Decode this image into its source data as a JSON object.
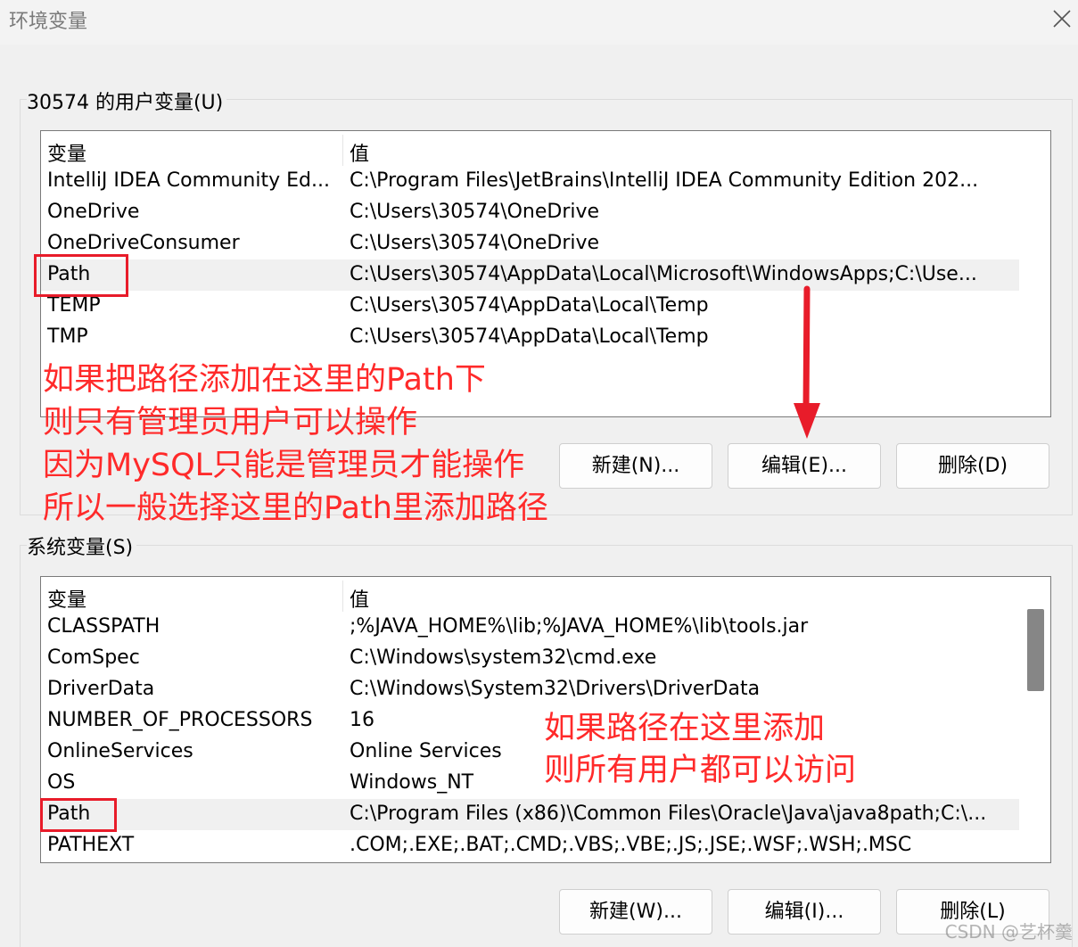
{
  "window": {
    "title": "环境变量",
    "close_icon": "close-icon"
  },
  "user_vars": {
    "group_label": "30574 的用户变量(U)",
    "columns": {
      "name": "变量",
      "value": "值"
    },
    "rows": [
      {
        "name": "IntelliJ IDEA Community Ed...",
        "value": "C:\\Program Files\\JetBrains\\IntelliJ IDEA Community Edition 202..."
      },
      {
        "name": "OneDrive",
        "value": "C:\\Users\\30574\\OneDrive"
      },
      {
        "name": "OneDriveConsumer",
        "value": "C:\\Users\\30574\\OneDrive"
      },
      {
        "name": "Path",
        "value": "C:\\Users\\30574\\AppData\\Local\\Microsoft\\WindowsApps;C:\\Use..."
      },
      {
        "name": "TEMP",
        "value": "C:\\Users\\30574\\AppData\\Local\\Temp"
      },
      {
        "name": "TMP",
        "value": "C:\\Users\\30574\\AppData\\Local\\Temp"
      }
    ],
    "selected_index": 3,
    "buttons": {
      "new": "新建(N)...",
      "edit": "编辑(E)...",
      "delete": "删除(D)"
    }
  },
  "system_vars": {
    "group_label": "系统变量(S)",
    "columns": {
      "name": "变量",
      "value": "值"
    },
    "rows": [
      {
        "name": "CLASSPATH",
        "value": ";%JAVA_HOME%\\lib;%JAVA_HOME%\\lib\\tools.jar"
      },
      {
        "name": "ComSpec",
        "value": "C:\\Windows\\system32\\cmd.exe"
      },
      {
        "name": "DriverData",
        "value": "C:\\Windows\\System32\\Drivers\\DriverData"
      },
      {
        "name": "NUMBER_OF_PROCESSORS",
        "value": "16"
      },
      {
        "name": "OnlineServices",
        "value": "Online Services"
      },
      {
        "name": "OS",
        "value": "Windows_NT"
      },
      {
        "name": "Path",
        "value": "C:\\Program Files (x86)\\Common Files\\Oracle\\Java\\java8path;C:\\..."
      },
      {
        "name": "PATHEXT",
        "value": ".COM;.EXE;.BAT;.CMD;.VBS;.VBE;.JS;.JSE;.WSF;.WSH;.MSC"
      }
    ],
    "selected_index": 6,
    "buttons": {
      "new": "新建(W)...",
      "edit": "编辑(I)...",
      "delete": "删除(L)"
    }
  },
  "annotations": {
    "user_note": [
      "如果把路径添加在这里的Path下",
      "则只有管理员用户可以操作",
      "因为MySQL只能是管理员才能操作",
      "所以一般选择这里的Path里添加路径"
    ],
    "system_note": [
      "如果路径在这里添加",
      "则所有用户都可以访问"
    ],
    "color": "#ff2a2a"
  },
  "watermark": "CSDN @艺杯羹"
}
